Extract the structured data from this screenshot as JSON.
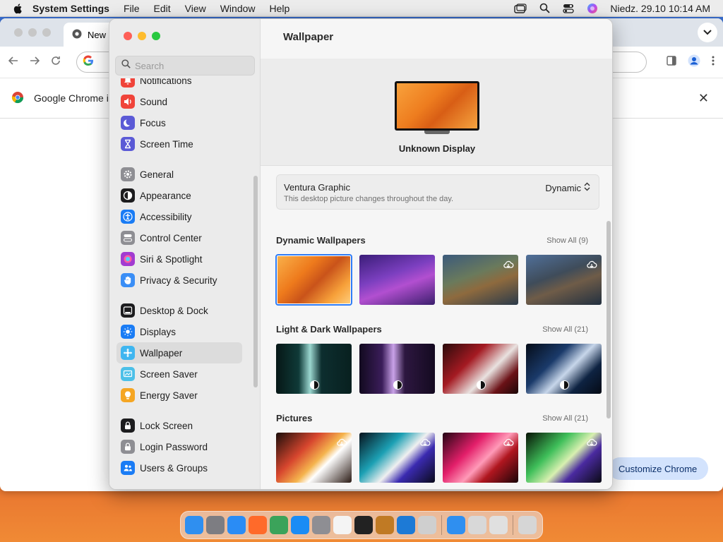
{
  "menubar": {
    "app_name": "System Settings",
    "menus": [
      "File",
      "Edit",
      "View",
      "Window",
      "Help"
    ],
    "datetime": "Niedz. 29.10  10:14 AM"
  },
  "chrome": {
    "tab_title": "New",
    "infobar_text": "Google Chrome i",
    "customize_label": "Customize Chrome"
  },
  "settings": {
    "search_placeholder": "Search",
    "sidebar": {
      "groups": [
        [
          {
            "label": "Notifications",
            "icon": "bell-icon",
            "color": "#f0443a"
          },
          {
            "label": "Sound",
            "icon": "speaker-icon",
            "color": "#f0443a"
          },
          {
            "label": "Focus",
            "icon": "moon-icon",
            "color": "#5b5ad6"
          },
          {
            "label": "Screen Time",
            "icon": "hourglass-icon",
            "color": "#5b5ad6"
          }
        ],
        [
          {
            "label": "General",
            "icon": "gear-icon",
            "color": "#8e8e93"
          },
          {
            "label": "Appearance",
            "icon": "appearance-icon",
            "color": "#1c1c1e"
          },
          {
            "label": "Accessibility",
            "icon": "accessibility-icon",
            "color": "#1a7cf5"
          },
          {
            "label": "Control Center",
            "icon": "control-center-icon",
            "color": "#8e8e93"
          },
          {
            "label": "Siri & Spotlight",
            "icon": "siri-icon",
            "color": "#a23bd1"
          },
          {
            "label": "Privacy & Security",
            "icon": "hand-icon",
            "color": "#3a8ef6"
          }
        ],
        [
          {
            "label": "Desktop & Dock",
            "icon": "dock-icon",
            "color": "#1c1c1e"
          },
          {
            "label": "Displays",
            "icon": "sun-icon",
            "color": "#1a7cf5"
          },
          {
            "label": "Wallpaper",
            "icon": "wallpaper-icon",
            "color": "#3fb6f0",
            "selected": true
          },
          {
            "label": "Screen Saver",
            "icon": "screen-saver-icon",
            "color": "#4cc0e8"
          },
          {
            "label": "Energy Saver",
            "icon": "bulb-icon",
            "color": "#f5a623"
          }
        ],
        [
          {
            "label": "Lock Screen",
            "icon": "lock-icon",
            "color": "#1c1c1e"
          },
          {
            "label": "Login Password",
            "icon": "lock-icon",
            "color": "#8e8e93"
          },
          {
            "label": "Users & Groups",
            "icon": "users-icon",
            "color": "#1a7cf5"
          }
        ]
      ]
    },
    "main": {
      "title": "Wallpaper",
      "display_name": "Unknown Display",
      "current": {
        "name": "Ventura Graphic",
        "description": "This desktop picture changes throughout the day.",
        "mode": "Dynamic"
      },
      "sections": [
        {
          "title": "Dynamic Wallpapers",
          "show_all": "Show All (9)",
          "thumbs": [
            {
              "gradient": "linear-gradient(135deg,#f9b04a 0%,#ee7a1c 35%,#c9531a 55%,#f7a13a 80%,#ffcc7a 100%)",
              "selected": true
            },
            {
              "gradient": "linear-gradient(160deg,#3a1d78 0%,#7b3fbf 40%,#b24fd0 60%,#3b1f6d 100%)"
            },
            {
              "gradient": "linear-gradient(160deg,#3b5a7c 0%,#6a7a5c 40%,#8e6a3e 60%,#2a3a4a 100%)",
              "badge": "cloud-download-icon"
            },
            {
              "gradient": "linear-gradient(160deg,#50709a 0%,#3f4c5a 40%,#6f5c48 60%,#223040 100%)",
              "badge": "cloud-download-icon"
            }
          ]
        },
        {
          "title": "Light & Dark Wallpapers",
          "show_all": "Show All (21)",
          "thumbs": [
            {
              "gradient": "linear-gradient(90deg,#061716 0%,#0f3a38 30%,#9bd7d0 45%,#0d2e2f 60%,#08201f 100%)",
              "daynight": true
            },
            {
              "gradient": "linear-gradient(90deg,#120a1f 0%,#3b1d5a 30%,#c9a2e8 45%,#2d1740 60%,#140a20 100%)",
              "daynight": true
            },
            {
              "gradient": "linear-gradient(135deg,#2a0b0b 0%,#a41a22 35%,#e9e2e0 60%,#6b1217 80%,#1b0707 100%)",
              "daynight": true
            },
            {
              "gradient": "linear-gradient(135deg,#050c18 0%,#1a3a6a 35%,#c7d6ea 55%,#0e2342 75%,#050a14 100%)",
              "daynight": true
            }
          ]
        },
        {
          "title": "Pictures",
          "show_all": "Show All (21)",
          "thumbs": [
            {
              "gradient": "linear-gradient(135deg,#1a0d0a 0%,#d7462e 35%,#f5b44d 55%,#ffffff 65%,#2a1a14 100%)",
              "badge": "cloud-download-icon"
            },
            {
              "gradient": "linear-gradient(135deg,#07121c 0%,#1ca0b4 35%,#f0f0f0 55%,#3a2ab0 70%,#0a0a1a 100%)",
              "badge": "cloud-download-icon"
            },
            {
              "gradient": "linear-gradient(135deg,#230513 0%,#e31f6a 35%,#ff9ab8 55%,#b0161f 70%,#1a0408 100%)",
              "badge": "cloud-download-icon"
            },
            {
              "gradient": "linear-gradient(135deg,#071205 0%,#3fbf5a 35%,#d8f0b0 55%,#4a2aa0 70%,#0a0a14 100%)",
              "badge": "cloud-download-icon"
            }
          ]
        }
      ]
    }
  },
  "dock": {
    "apps": [
      {
        "name": "finder-icon",
        "color": "#2f8ff0"
      },
      {
        "name": "launchpad-icon",
        "color": "#7d7d82"
      },
      {
        "name": "safari-icon",
        "color": "#2a8cf5"
      },
      {
        "name": "firefox-icon",
        "color": "#ff6a2a"
      },
      {
        "name": "chrome-icon",
        "color": "#3ba35a"
      },
      {
        "name": "app-store-icon",
        "color": "#1a8cf5"
      },
      {
        "name": "system-settings-icon",
        "color": "#8e8e93"
      },
      {
        "name": "textedit-icon",
        "color": "#f4f4f4"
      },
      {
        "name": "terminal-icon",
        "color": "#222222"
      },
      {
        "name": "instruments-icon",
        "color": "#c07a24"
      },
      {
        "name": "vscode-icon",
        "color": "#1d7ad6"
      },
      {
        "name": "preview-icon",
        "color": "#cfcfcf"
      },
      {
        "name": "separator"
      },
      {
        "name": "weather-icon",
        "color": "#2f8ff0"
      },
      {
        "name": "script-editor-icon",
        "color": "#d8d8d8"
      },
      {
        "name": "printer-icon",
        "color": "#e0e0e0"
      },
      {
        "name": "separator"
      },
      {
        "name": "trash-icon",
        "color": "#d6d6d6"
      }
    ]
  }
}
